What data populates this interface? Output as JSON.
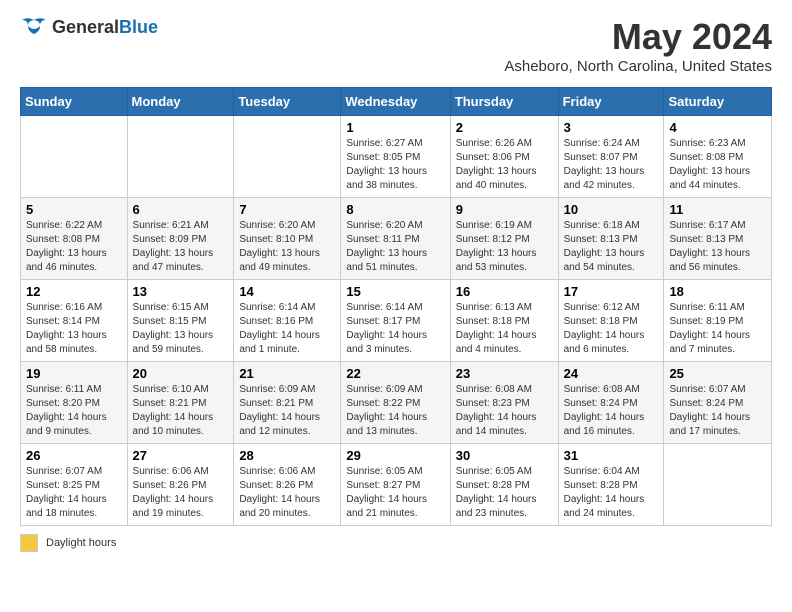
{
  "header": {
    "logo_general": "General",
    "logo_blue": "Blue",
    "title": "May 2024",
    "subtitle": "Asheboro, North Carolina, United States"
  },
  "footer": {
    "legend_label": "Daylight hours"
  },
  "weekdays": [
    "Sunday",
    "Monday",
    "Tuesday",
    "Wednesday",
    "Thursday",
    "Friday",
    "Saturday"
  ],
  "weeks": [
    [
      {
        "day": "",
        "info": ""
      },
      {
        "day": "",
        "info": ""
      },
      {
        "day": "",
        "info": ""
      },
      {
        "day": "1",
        "info": "Sunrise: 6:27 AM\nSunset: 8:05 PM\nDaylight: 13 hours and 38 minutes."
      },
      {
        "day": "2",
        "info": "Sunrise: 6:26 AM\nSunset: 8:06 PM\nDaylight: 13 hours and 40 minutes."
      },
      {
        "day": "3",
        "info": "Sunrise: 6:24 AM\nSunset: 8:07 PM\nDaylight: 13 hours and 42 minutes."
      },
      {
        "day": "4",
        "info": "Sunrise: 6:23 AM\nSunset: 8:08 PM\nDaylight: 13 hours and 44 minutes."
      }
    ],
    [
      {
        "day": "5",
        "info": "Sunrise: 6:22 AM\nSunset: 8:08 PM\nDaylight: 13 hours and 46 minutes."
      },
      {
        "day": "6",
        "info": "Sunrise: 6:21 AM\nSunset: 8:09 PM\nDaylight: 13 hours and 47 minutes."
      },
      {
        "day": "7",
        "info": "Sunrise: 6:20 AM\nSunset: 8:10 PM\nDaylight: 13 hours and 49 minutes."
      },
      {
        "day": "8",
        "info": "Sunrise: 6:20 AM\nSunset: 8:11 PM\nDaylight: 13 hours and 51 minutes."
      },
      {
        "day": "9",
        "info": "Sunrise: 6:19 AM\nSunset: 8:12 PM\nDaylight: 13 hours and 53 minutes."
      },
      {
        "day": "10",
        "info": "Sunrise: 6:18 AM\nSunset: 8:13 PM\nDaylight: 13 hours and 54 minutes."
      },
      {
        "day": "11",
        "info": "Sunrise: 6:17 AM\nSunset: 8:13 PM\nDaylight: 13 hours and 56 minutes."
      }
    ],
    [
      {
        "day": "12",
        "info": "Sunrise: 6:16 AM\nSunset: 8:14 PM\nDaylight: 13 hours and 58 minutes."
      },
      {
        "day": "13",
        "info": "Sunrise: 6:15 AM\nSunset: 8:15 PM\nDaylight: 13 hours and 59 minutes."
      },
      {
        "day": "14",
        "info": "Sunrise: 6:14 AM\nSunset: 8:16 PM\nDaylight: 14 hours and 1 minute."
      },
      {
        "day": "15",
        "info": "Sunrise: 6:14 AM\nSunset: 8:17 PM\nDaylight: 14 hours and 3 minutes."
      },
      {
        "day": "16",
        "info": "Sunrise: 6:13 AM\nSunset: 8:18 PM\nDaylight: 14 hours and 4 minutes."
      },
      {
        "day": "17",
        "info": "Sunrise: 6:12 AM\nSunset: 8:18 PM\nDaylight: 14 hours and 6 minutes."
      },
      {
        "day": "18",
        "info": "Sunrise: 6:11 AM\nSunset: 8:19 PM\nDaylight: 14 hours and 7 minutes."
      }
    ],
    [
      {
        "day": "19",
        "info": "Sunrise: 6:11 AM\nSunset: 8:20 PM\nDaylight: 14 hours and 9 minutes."
      },
      {
        "day": "20",
        "info": "Sunrise: 6:10 AM\nSunset: 8:21 PM\nDaylight: 14 hours and 10 minutes."
      },
      {
        "day": "21",
        "info": "Sunrise: 6:09 AM\nSunset: 8:21 PM\nDaylight: 14 hours and 12 minutes."
      },
      {
        "day": "22",
        "info": "Sunrise: 6:09 AM\nSunset: 8:22 PM\nDaylight: 14 hours and 13 minutes."
      },
      {
        "day": "23",
        "info": "Sunrise: 6:08 AM\nSunset: 8:23 PM\nDaylight: 14 hours and 14 minutes."
      },
      {
        "day": "24",
        "info": "Sunrise: 6:08 AM\nSunset: 8:24 PM\nDaylight: 14 hours and 16 minutes."
      },
      {
        "day": "25",
        "info": "Sunrise: 6:07 AM\nSunset: 8:24 PM\nDaylight: 14 hours and 17 minutes."
      }
    ],
    [
      {
        "day": "26",
        "info": "Sunrise: 6:07 AM\nSunset: 8:25 PM\nDaylight: 14 hours and 18 minutes."
      },
      {
        "day": "27",
        "info": "Sunrise: 6:06 AM\nSunset: 8:26 PM\nDaylight: 14 hours and 19 minutes."
      },
      {
        "day": "28",
        "info": "Sunrise: 6:06 AM\nSunset: 8:26 PM\nDaylight: 14 hours and 20 minutes."
      },
      {
        "day": "29",
        "info": "Sunrise: 6:05 AM\nSunset: 8:27 PM\nDaylight: 14 hours and 21 minutes."
      },
      {
        "day": "30",
        "info": "Sunrise: 6:05 AM\nSunset: 8:28 PM\nDaylight: 14 hours and 23 minutes."
      },
      {
        "day": "31",
        "info": "Sunrise: 6:04 AM\nSunset: 8:28 PM\nDaylight: 14 hours and 24 minutes."
      },
      {
        "day": "",
        "info": ""
      }
    ]
  ]
}
